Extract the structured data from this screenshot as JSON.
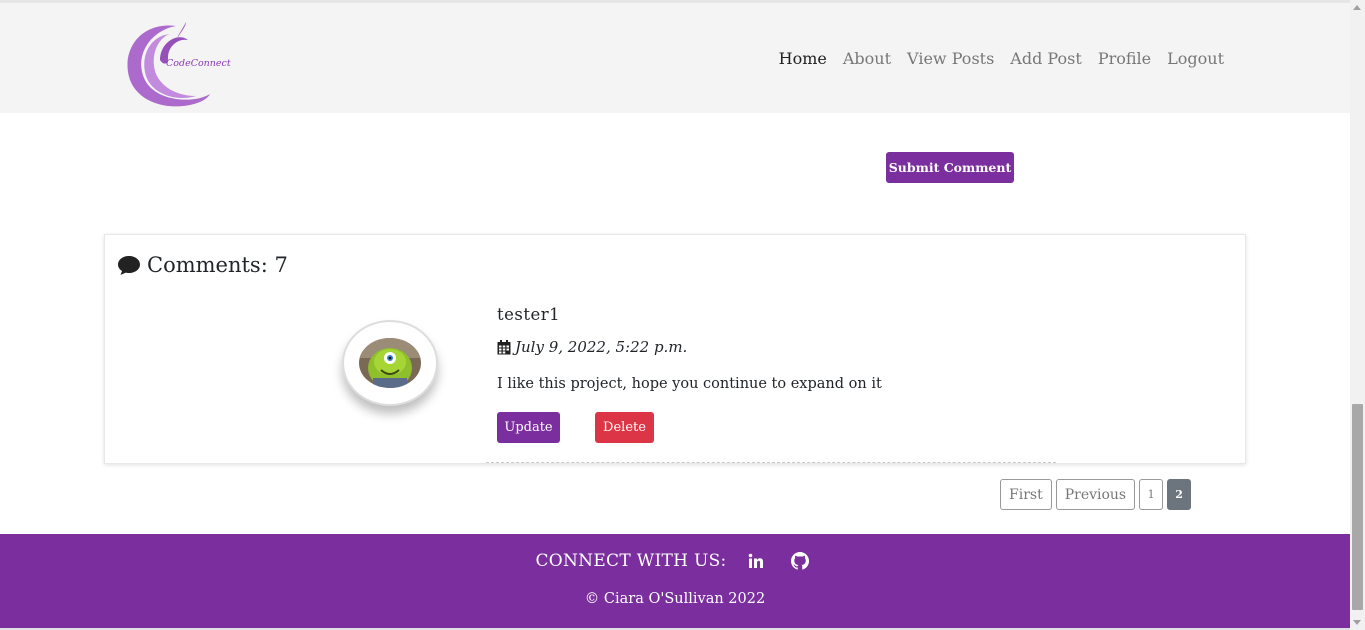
{
  "brand": {
    "logo_text": "CodeConnect",
    "color": "#7b2f9e"
  },
  "nav": {
    "items": [
      {
        "label": "Home",
        "active": true
      },
      {
        "label": "About"
      },
      {
        "label": "View Posts"
      },
      {
        "label": "Add Post"
      },
      {
        "label": "Profile"
      },
      {
        "label": "Logout"
      }
    ]
  },
  "comment_form": {
    "submit_label": "Submit Comment"
  },
  "comments": {
    "title": "Comments: 7",
    "icon": "comment-icon",
    "items": [
      {
        "author": "tester1",
        "date": "July 9, 2022, 5:22 p.m.",
        "text": "I like this project, hope you continue to expand on it",
        "update_label": "Update",
        "delete_label": "Delete"
      }
    ]
  },
  "pagination": {
    "first": "First",
    "previous": "Previous",
    "pages": [
      "1",
      "2"
    ],
    "current": "2"
  },
  "footer": {
    "connect_label": "CONNECT WITH US:",
    "social": [
      "linkedin-icon",
      "github-icon"
    ],
    "copyright": "© Ciara O'Sullivan 2022"
  },
  "colors": {
    "primary": "#7b2f9e",
    "danger": "#dc3545",
    "pagination_active": "#6c757d",
    "navbar_bg": "#f4f4f4"
  }
}
